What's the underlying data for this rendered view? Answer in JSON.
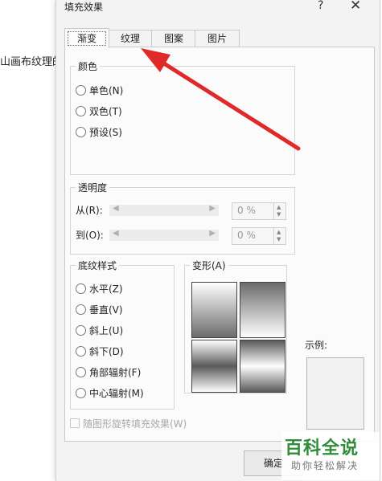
{
  "background_text": "山画布纹理的",
  "dialog": {
    "title": "填充效果",
    "help": "?",
    "close": "✕",
    "tabs": [
      "渐变",
      "纹理",
      "图案",
      "图片"
    ],
    "colors_group": {
      "label": "颜色",
      "options": [
        "单色(N)",
        "双色(T)",
        "预设(S)"
      ]
    },
    "transparency": {
      "label": "透明度",
      "from_label": "从(R):",
      "to_label": "到(O):",
      "from_value": "0 %",
      "to_value": "0 %"
    },
    "shading": {
      "label": "底纹样式",
      "options": [
        "水平(Z)",
        "垂直(V)",
        "斜上(U)",
        "斜下(D)",
        "角部辐射(F)",
        "中心辐射(M)"
      ]
    },
    "variants_label": "变形(A)",
    "preview_label": "示例:",
    "rotate_checkbox": "随图形旋转填充效果(W)",
    "ok_button": "确定"
  },
  "watermark": {
    "title": "百科全说",
    "subtitle": "助你轻松解决"
  },
  "colors": {
    "arrow": "#e02a2a",
    "watermark_green": "#2f8d3a"
  }
}
